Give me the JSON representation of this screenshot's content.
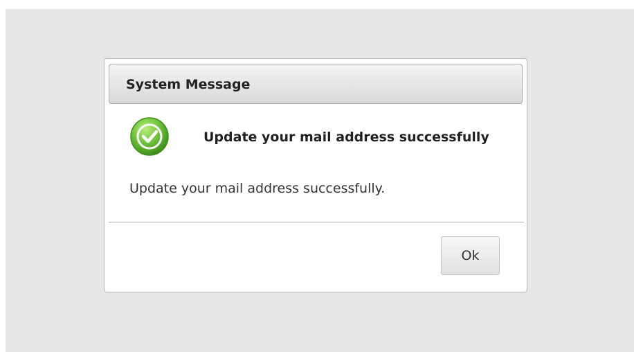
{
  "dialog": {
    "title": "System Message",
    "icon": "success-check-icon",
    "heading": "Update your mail address successfully",
    "message": "Update your mail address successfully.",
    "ok_label": "Ok"
  },
  "colors": {
    "backdrop": "#e6e6e6",
    "icon_green": "#6cc13a",
    "icon_dark_green": "#3f8f1b"
  }
}
